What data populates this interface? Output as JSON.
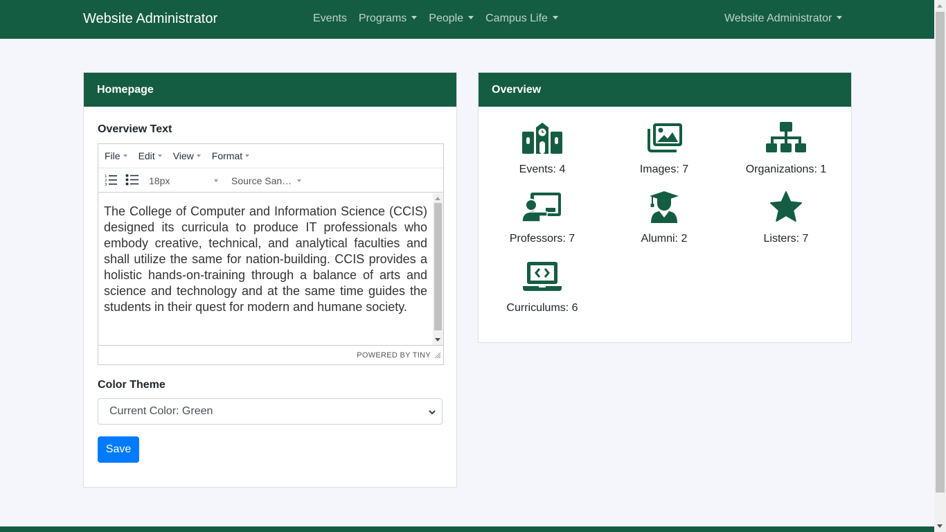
{
  "navbar": {
    "brand": "Website Administrator",
    "links": [
      "Events",
      "Programs",
      "People",
      "Campus Life"
    ],
    "user": "Website Administrator"
  },
  "homepage_card": {
    "title": "Homepage",
    "overview_label": "Overview Text",
    "editor": {
      "menu": [
        "File",
        "Edit",
        "View",
        "Format"
      ],
      "font_size": "18px",
      "font_family": "Source San…",
      "content": "The College of Computer and Information Science (CCIS) designed its curricula to produce IT professionals who embody creative, technical, and analytical faculties and shall utilize the same for nation-building. CCIS provides a holistic hands-on-training through a balance of arts and science and technology and at the same time guides the students in their quest for modern and humane society.",
      "powered_by": "POWERED BY TINY"
    },
    "color_theme_label": "Color Theme",
    "color_select_value": "Current Color: Green",
    "save_label": "Save"
  },
  "overview_card": {
    "title": "Overview",
    "stats": [
      {
        "label": "Events: 4",
        "icon": "school-icon"
      },
      {
        "label": "Images: 7",
        "icon": "images-icon"
      },
      {
        "label": "Organizations: 1",
        "icon": "sitemap-icon"
      },
      {
        "label": "Professors: 7",
        "icon": "chalkboard-teacher-icon"
      },
      {
        "label": "Alumni: 2",
        "icon": "graduate-icon"
      },
      {
        "label": "Listers: 7",
        "icon": "star-icon"
      },
      {
        "label": "Curriculums: 6",
        "icon": "laptop-code-icon"
      }
    ]
  },
  "colors": {
    "brand_green": "#155d42",
    "primary_button": "#007bff",
    "page_background": "#f4f6fb"
  }
}
